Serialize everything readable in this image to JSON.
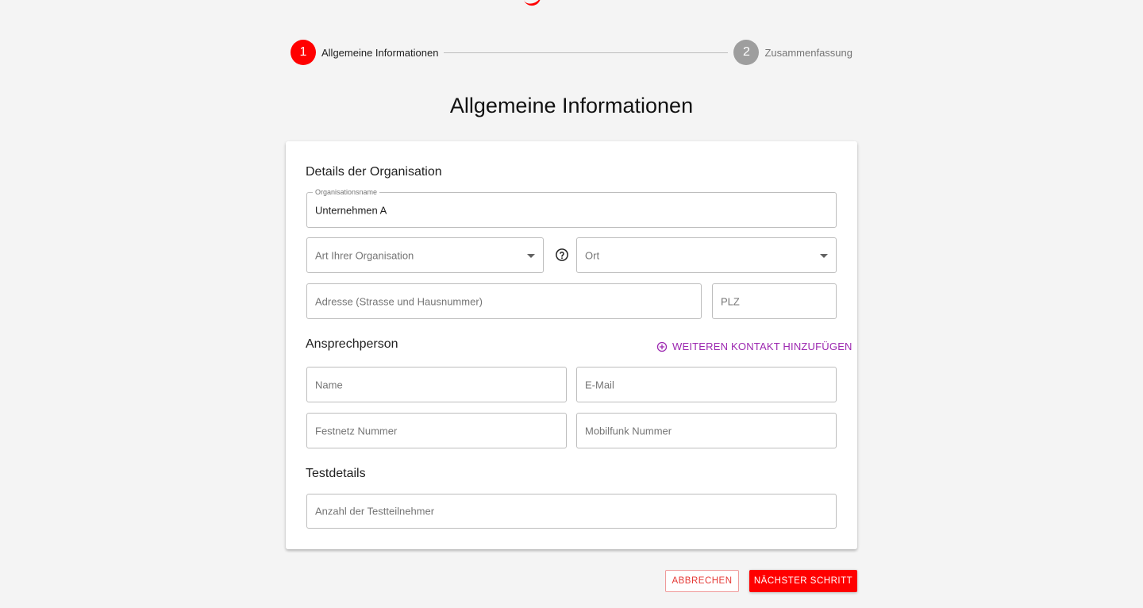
{
  "stepper": {
    "steps": [
      {
        "number": "1",
        "label": "Allgemeine Informationen",
        "state": "active"
      },
      {
        "number": "2",
        "label": "Zusammenfassung",
        "state": "inactive"
      }
    ]
  },
  "page_title": "Allgemeine Informationen",
  "organization": {
    "section_title": "Details der Organisation",
    "name_label": "Organisationsname",
    "name_value": "Unternehmen A",
    "type_placeholder": "Art Ihrer Organisation",
    "location_placeholder": "Ort",
    "address_placeholder": "Adresse (Strasse und Hausnummer)",
    "zip_placeholder": "PLZ"
  },
  "contact": {
    "section_title": "Ansprechperson",
    "add_contact_label": "WEITEREN KONTAKT HINZUFÜGEN",
    "name_placeholder": "Name",
    "email_placeholder": "E-Mail",
    "landline_placeholder": "Festnetz Nummer",
    "mobile_placeholder": "Mobilfunk Nummer"
  },
  "test": {
    "section_title": "Testdetails",
    "participants_placeholder": "Anzahl der Testteilnehmer"
  },
  "actions": {
    "cancel_label": "ABBRECHEN",
    "next_label": "NÄCHSTER SCHRITT"
  },
  "colors": {
    "primary": "#ff0000",
    "accent": "#9c27b0",
    "inactive_step": "#9e9e9e"
  }
}
